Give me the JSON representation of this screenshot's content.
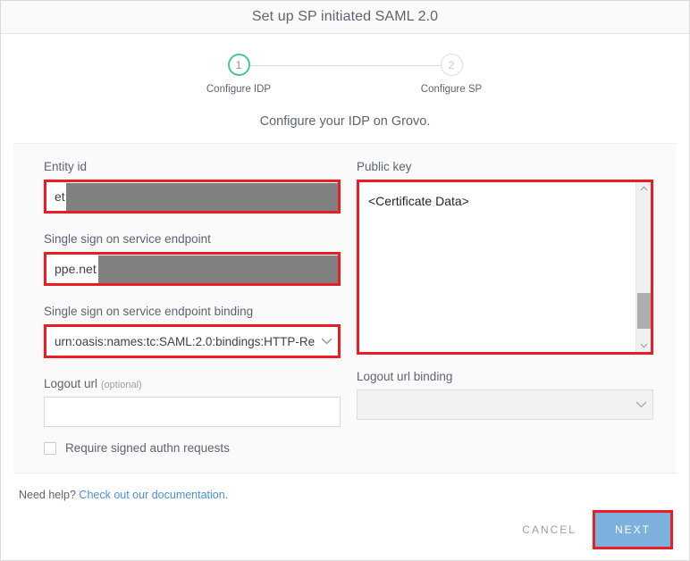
{
  "window": {
    "title": "Set up SP initiated SAML 2.0"
  },
  "stepper": {
    "steps": [
      {
        "number": "1",
        "label": "Configure IDP",
        "state": "active"
      },
      {
        "number": "2",
        "label": "Configure SP",
        "state": "inactive"
      }
    ],
    "active_color": "#4dc3a3"
  },
  "subtitle": "Configure your IDP on Grovo.",
  "form": {
    "left": {
      "entity_id": {
        "label": "Entity id",
        "value_prefix": "et",
        "redacted": true,
        "highlighted": true
      },
      "sso_endpoint": {
        "label": "Single sign on service endpoint",
        "value_prefix": "ppe.net",
        "redacted": true,
        "highlighted": true
      },
      "sso_binding": {
        "label": "Single sign on service endpoint binding",
        "value": "urn:oasis:names:tc:SAML:2.0:bindings:HTTP-Re",
        "highlighted": true,
        "icon": "chevron-down-icon"
      },
      "logout_url": {
        "label": "Logout url",
        "label_optional": "(optional)",
        "value": "",
        "placeholder": ""
      },
      "require_signed": {
        "label": "Require signed authn requests",
        "checked": false
      }
    },
    "right": {
      "public_key": {
        "label": "Public key",
        "value": "<Certificate Data>",
        "highlighted": true,
        "scrollbar": {
          "up_icon": "chevron-up-icon",
          "down_icon": "chevron-down-icon"
        }
      },
      "logout_url_binding": {
        "label": "Logout url binding",
        "value": "",
        "disabled": true,
        "icon": "chevron-down-icon"
      }
    }
  },
  "footer": {
    "help_text": "Need help? ",
    "help_link": "Check out our documentation.",
    "cancel_label": "CANCEL",
    "next_label": "NEXT",
    "next_color": "#7db0dc",
    "highlight_color": "#ec1c24"
  }
}
